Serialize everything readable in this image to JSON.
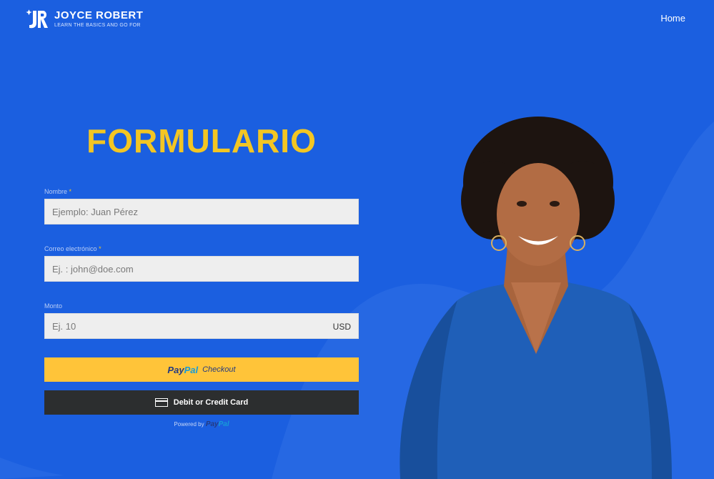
{
  "header": {
    "brand_name": "JOYCE ROBERT",
    "brand_tagline": "LEARN THE BASICS AND GO FOR",
    "nav_home": "Home"
  },
  "form": {
    "title": "FORMULARIO",
    "name_label": "Nombre",
    "name_placeholder": "Ejemplo: Juan Pérez",
    "email_label": "Correo electrónico",
    "email_placeholder": "Ej. : john@doe.com",
    "amount_label": "Monto",
    "amount_placeholder": "Ej. 10",
    "currency": "USD",
    "required_mark": "*"
  },
  "payment": {
    "paypal_logo_part1": "Pay",
    "paypal_logo_part2": "Pal",
    "paypal_checkout": "Checkout",
    "card_button": "Debit or Credit Card",
    "powered_by": "Powered by",
    "powered_logo_part1": "Pay",
    "powered_logo_part2": "Pal"
  },
  "colors": {
    "background": "#1b5fe0",
    "title": "#f3c623",
    "paypal_button": "#ffc439",
    "card_button": "#2c2e2f"
  }
}
